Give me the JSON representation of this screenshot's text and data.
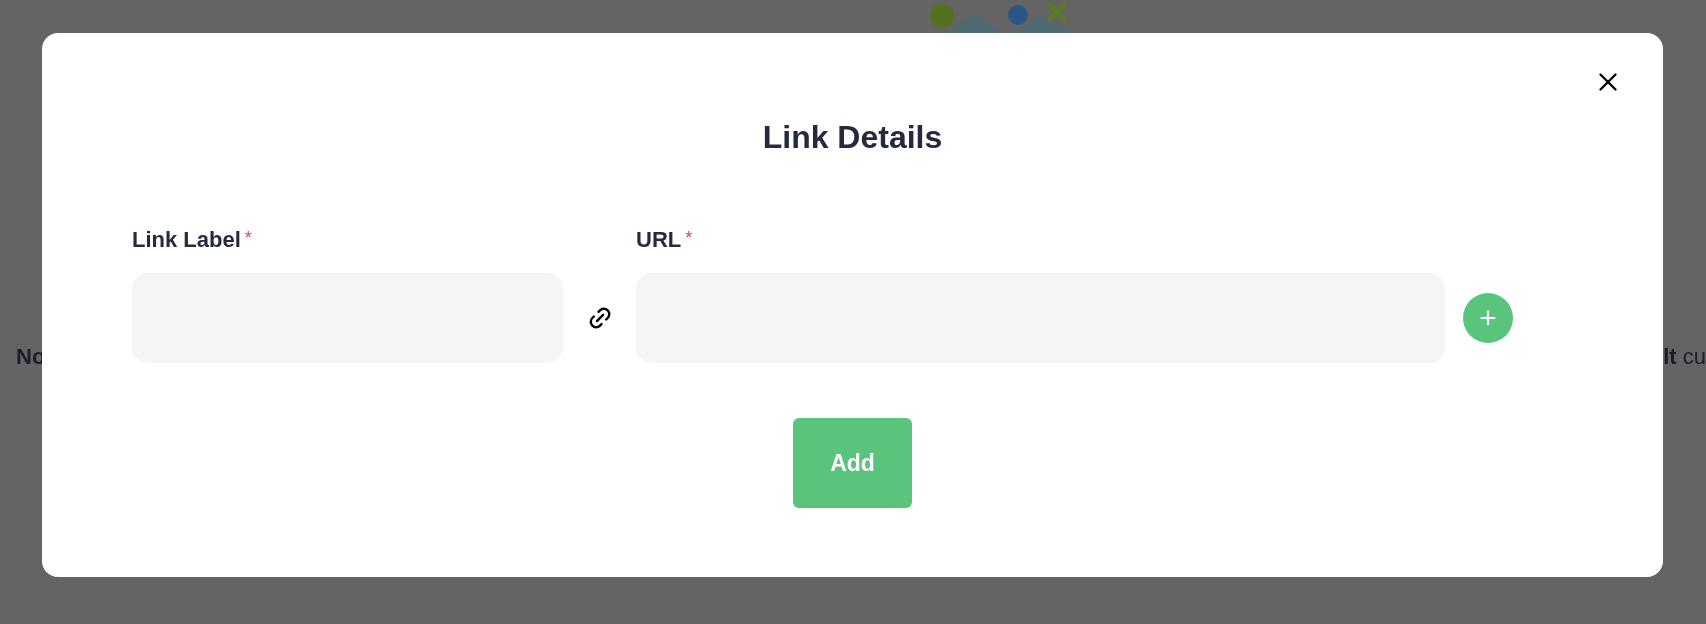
{
  "background": {
    "left_text": "No",
    "right_text": "**lt** cu"
  },
  "dialog": {
    "title": "Link Details",
    "fields": [
      {
        "label": "Link Label",
        "required_mark": "*"
      },
      {
        "label": "URL",
        "required_mark": "*"
      }
    ],
    "add_row_button": "+",
    "submit_button": "Add"
  }
}
